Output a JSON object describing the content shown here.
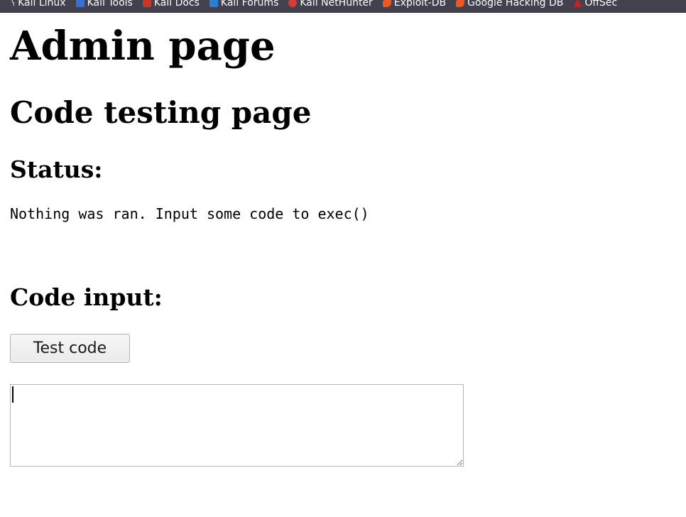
{
  "bookmarks": [
    {
      "label": "Kali Linux",
      "icon": "kali-dragon-icon"
    },
    {
      "label": "Kali Tools",
      "icon": "kali-tools-icon"
    },
    {
      "label": "Kali Docs",
      "icon": "kali-docs-icon"
    },
    {
      "label": "Kali Forums",
      "icon": "kali-forums-icon"
    },
    {
      "label": "Kali NetHunter",
      "icon": "nethunter-icon"
    },
    {
      "label": "Exploit-DB",
      "icon": "exploit-db-icon"
    },
    {
      "label": "Google Hacking DB",
      "icon": "ghdb-icon"
    },
    {
      "label": "OffSec",
      "icon": "offsec-icon"
    }
  ],
  "page": {
    "title": "Admin page",
    "subtitle": "Code testing page",
    "status_heading": "Status:",
    "status_message": "Nothing was ran. Input some code to exec()",
    "input_heading": "Code input:",
    "button_label": "Test code",
    "textarea_value": ""
  },
  "colors": {
    "bookmarks_bar_bg": "#42414d",
    "bookmarks_text": "#fbfbfe",
    "page_bg": "#ffffff"
  }
}
